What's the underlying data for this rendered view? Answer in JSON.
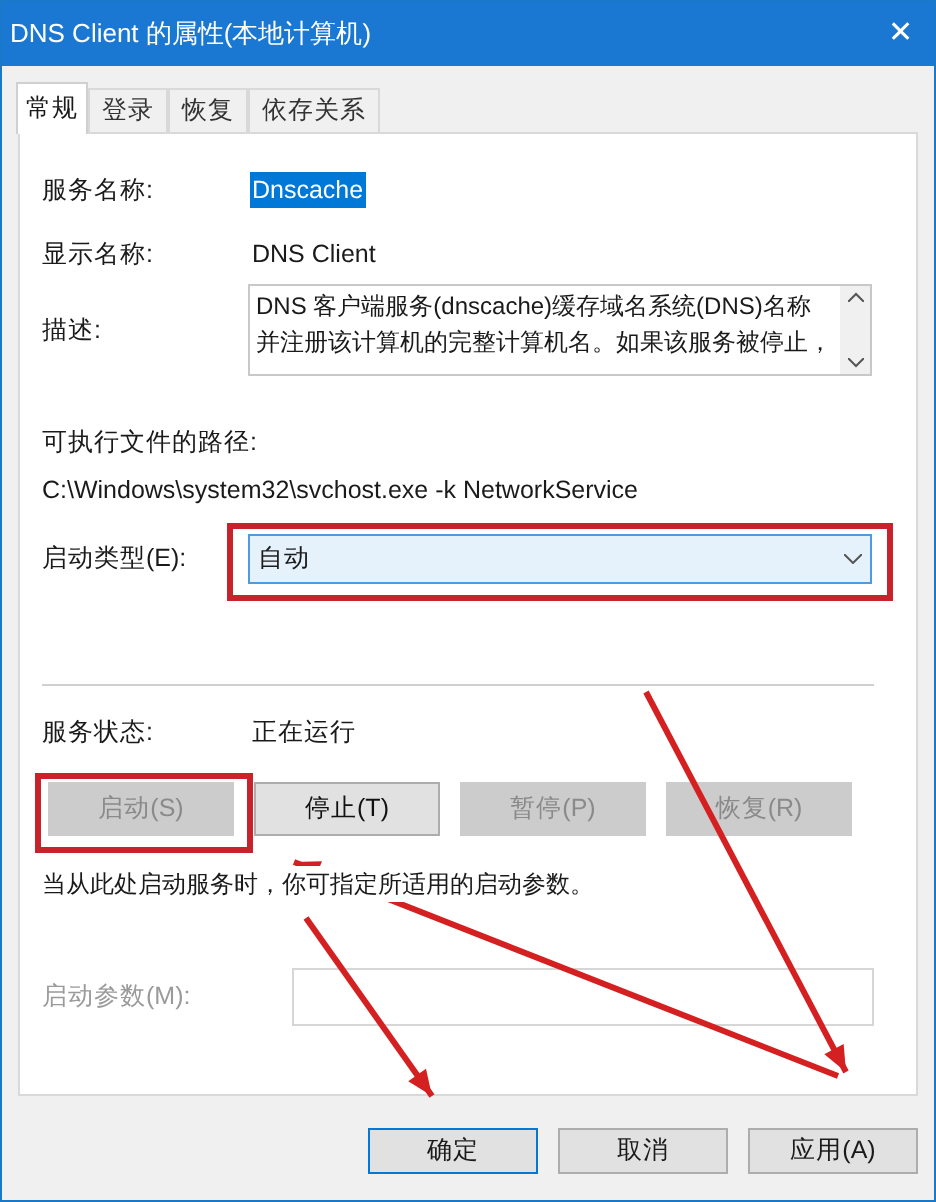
{
  "window": {
    "title": "DNS Client 的属性(本地计算机)",
    "close": "✕"
  },
  "tabs": [
    {
      "label": "常规",
      "selected": true
    },
    {
      "label": "登录",
      "selected": false
    },
    {
      "label": "恢复",
      "selected": false
    },
    {
      "label": "依存关系",
      "selected": false
    }
  ],
  "service_name": {
    "label": "服务名称:",
    "value": "Dnscache",
    "selected": true
  },
  "display_name": {
    "label": "显示名称:",
    "value": "DNS Client"
  },
  "description": {
    "label": "描述:",
    "value": "DNS 客户端服务(dnscache)缓存域名系统(DNS)名称并注册该计算机的完整计算机名。如果该服务被停止，"
  },
  "executable_path": {
    "label": "可执行文件的路径:",
    "value": "C:\\Windows\\system32\\svchost.exe -k NetworkService"
  },
  "startup_type": {
    "label": "启动类型(E):",
    "value": "自动"
  },
  "service_status": {
    "label": "服务状态:",
    "value": "正在运行"
  },
  "service_buttons": [
    {
      "label": "启动(S)",
      "disabled": true
    },
    {
      "label": "停止(T)",
      "disabled": false
    },
    {
      "label": "暂停(P)",
      "disabled": true
    },
    {
      "label": "恢复(R)",
      "disabled": true
    }
  ],
  "hint": "当从此处启动服务时，你可指定所适用的启动参数。",
  "start_parameters": {
    "label": "启动参数(M):",
    "disabled": true
  },
  "dialog_buttons": [
    {
      "label": "确定",
      "selected": true
    },
    {
      "label": "取消",
      "selected": false
    },
    {
      "label": "应用(A)",
      "selected": false
    }
  ]
}
